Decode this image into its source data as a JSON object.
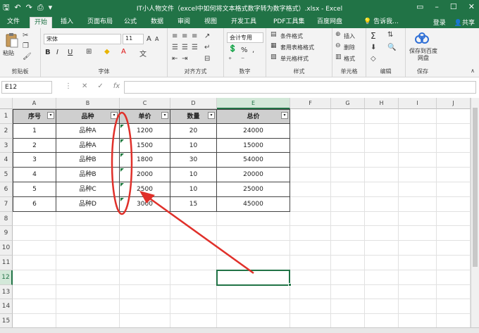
{
  "titlebar": {
    "title": "IT小人物文件（excel中如何将文本格式数字转为数字格式）.xlsx - Excel",
    "undo_icon": "undo-icon",
    "redo_icon": "redo-icon",
    "save_icon": "save-icon"
  },
  "tabs": [
    "文件",
    "开始",
    "插入",
    "页面布局",
    "公式",
    "数据",
    "审阅",
    "视图",
    "开发工具",
    "PDF工具集",
    "百度网盘"
  ],
  "active_tab": "开始",
  "tell_me": "告诉我...",
  "login": "登录",
  "share": "共享",
  "ribbon": {
    "clipboard": {
      "paste": "粘贴",
      "label": "剪贴板"
    },
    "font": {
      "name": "宋体",
      "size": "11",
      "label": "字体",
      "bold": "B",
      "italic": "I",
      "underline": "U",
      "grow": "A",
      "shrink": "A",
      "color_a": "A"
    },
    "alignment": {
      "label": "对齐方式"
    },
    "number": {
      "format": "会计专用",
      "percent": "%",
      "comma": ",",
      "label": "数字"
    },
    "styles": {
      "conditional": "条件格式",
      "table": "套用表格格式",
      "cell": "单元格样式",
      "label": "样式"
    },
    "cells": {
      "insert": "插入",
      "delete": "删除",
      "format": "格式",
      "label": "单元格"
    },
    "editing": {
      "sum": "Σ",
      "label": "编辑"
    },
    "save": {
      "button": "保存到百度网盘",
      "label": "保存"
    }
  },
  "formula_bar": {
    "name_box": "E12",
    "fx": "fx",
    "value": ""
  },
  "sheet": {
    "columns": [
      "A",
      "B",
      "C",
      "D",
      "E",
      "F",
      "G",
      "H",
      "I",
      "J"
    ],
    "rows": [
      "1",
      "2",
      "3",
      "4",
      "5",
      "6",
      "7",
      "8",
      "9",
      "10",
      "11",
      "12",
      "13",
      "14",
      "15"
    ],
    "selected_column": "E",
    "selected_row": "12",
    "headers": [
      "序号",
      "品种",
      "单价",
      "数量",
      "总价"
    ],
    "data": [
      [
        "1",
        "品种A",
        "1200",
        "20",
        "24000"
      ],
      [
        "2",
        "品种A",
        "1500",
        "10",
        "15000"
      ],
      [
        "3",
        "品种B",
        "1800",
        "30",
        "54000"
      ],
      [
        "4",
        "品种B",
        "2000",
        "10",
        "20000"
      ],
      [
        "5",
        "品种C",
        "2500",
        "10",
        "25000"
      ],
      [
        "6",
        "品种D",
        "3000",
        "15",
        "45000"
      ]
    ]
  },
  "annotation": {
    "color": "#e0302a"
  },
  "accent": "#217346"
}
